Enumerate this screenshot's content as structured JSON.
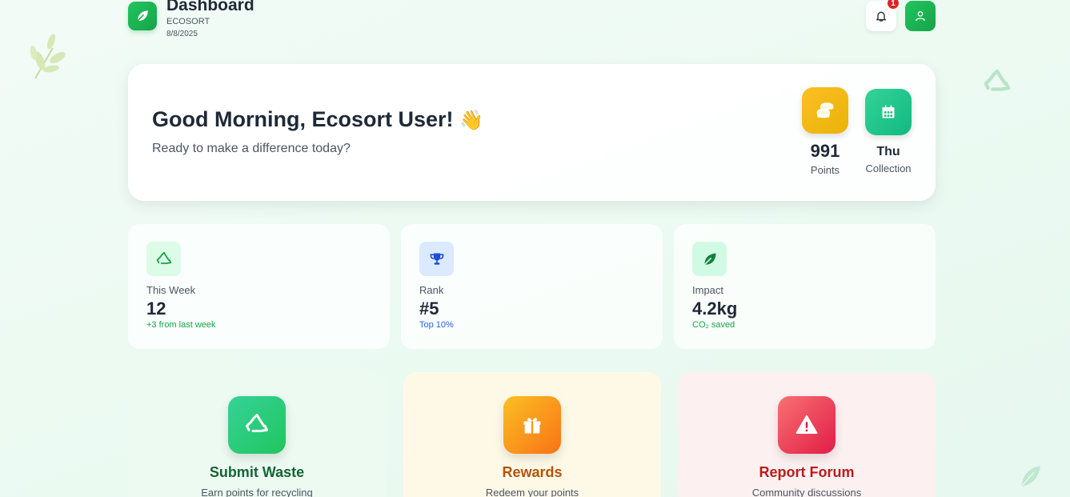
{
  "header": {
    "title": "Dashboard",
    "brand": "ECOSORT",
    "date": "8/8/2025",
    "notification_count": "1"
  },
  "greeting": {
    "title": "Good Morning, Ecosort User!",
    "emoji": "👋",
    "subtitle": "Ready to make a difference today?",
    "points_value": "991",
    "points_label": "Points",
    "collection_day": "Thu",
    "collection_label": "Collection"
  },
  "stats": [
    {
      "label": "This Week",
      "value": "12",
      "sub": "+3 from last week",
      "icon": "recycle-icon",
      "accent": "#16a34a"
    },
    {
      "label": "Rank",
      "value": "#5",
      "sub": "Top 10%",
      "icon": "trophy-icon",
      "accent": "#2563eb"
    },
    {
      "label": "Impact",
      "value": "4.2kg",
      "sub": "CO₂ saved",
      "icon": "leaf-icon",
      "accent": "#16a34a"
    }
  ],
  "actions": [
    {
      "title": "Submit Waste",
      "desc": "Earn points for recycling",
      "icon": "recycle-icon",
      "color": "#166534"
    },
    {
      "title": "Rewards",
      "desc": "Redeem your points",
      "icon": "gift-icon",
      "color": "#b45309"
    },
    {
      "title": "Report Forum",
      "desc": "Community discussions",
      "icon": "warning-icon",
      "color": "#b91c1c"
    }
  ]
}
